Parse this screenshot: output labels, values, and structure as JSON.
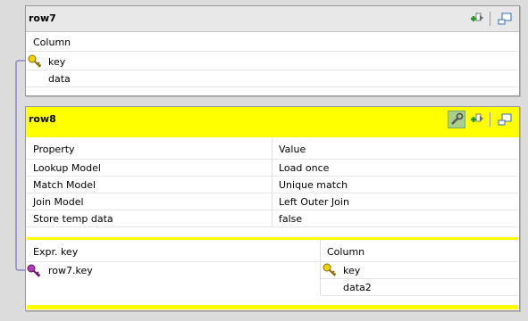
{
  "table_row7": {
    "title": "row7",
    "column_header": "Column",
    "rows": [
      {
        "name": "key"
      },
      {
        "name": "data"
      }
    ]
  },
  "table_row8": {
    "title": "row8",
    "props_header": {
      "property": "Property",
      "value": "Value"
    },
    "props": [
      {
        "property": "Lookup Model",
        "value": "Load once"
      },
      {
        "property": "Match Model",
        "value": "Unique match"
      },
      {
        "property": "Join Model",
        "value": "Left Outer Join"
      },
      {
        "property": "Store temp data",
        "value": "false"
      }
    ],
    "expr_header": "Expr. key",
    "expr_rows": [
      "row7.key"
    ],
    "col_header": "Column",
    "col_rows": [
      "key",
      "data2"
    ]
  },
  "colors": {
    "selected_header": "#ffff00",
    "gray_header": "#e8e8e8",
    "link_line": "#8a86c9",
    "key_yellow": "#e8c800",
    "key_purple": "#9a2a9a"
  }
}
